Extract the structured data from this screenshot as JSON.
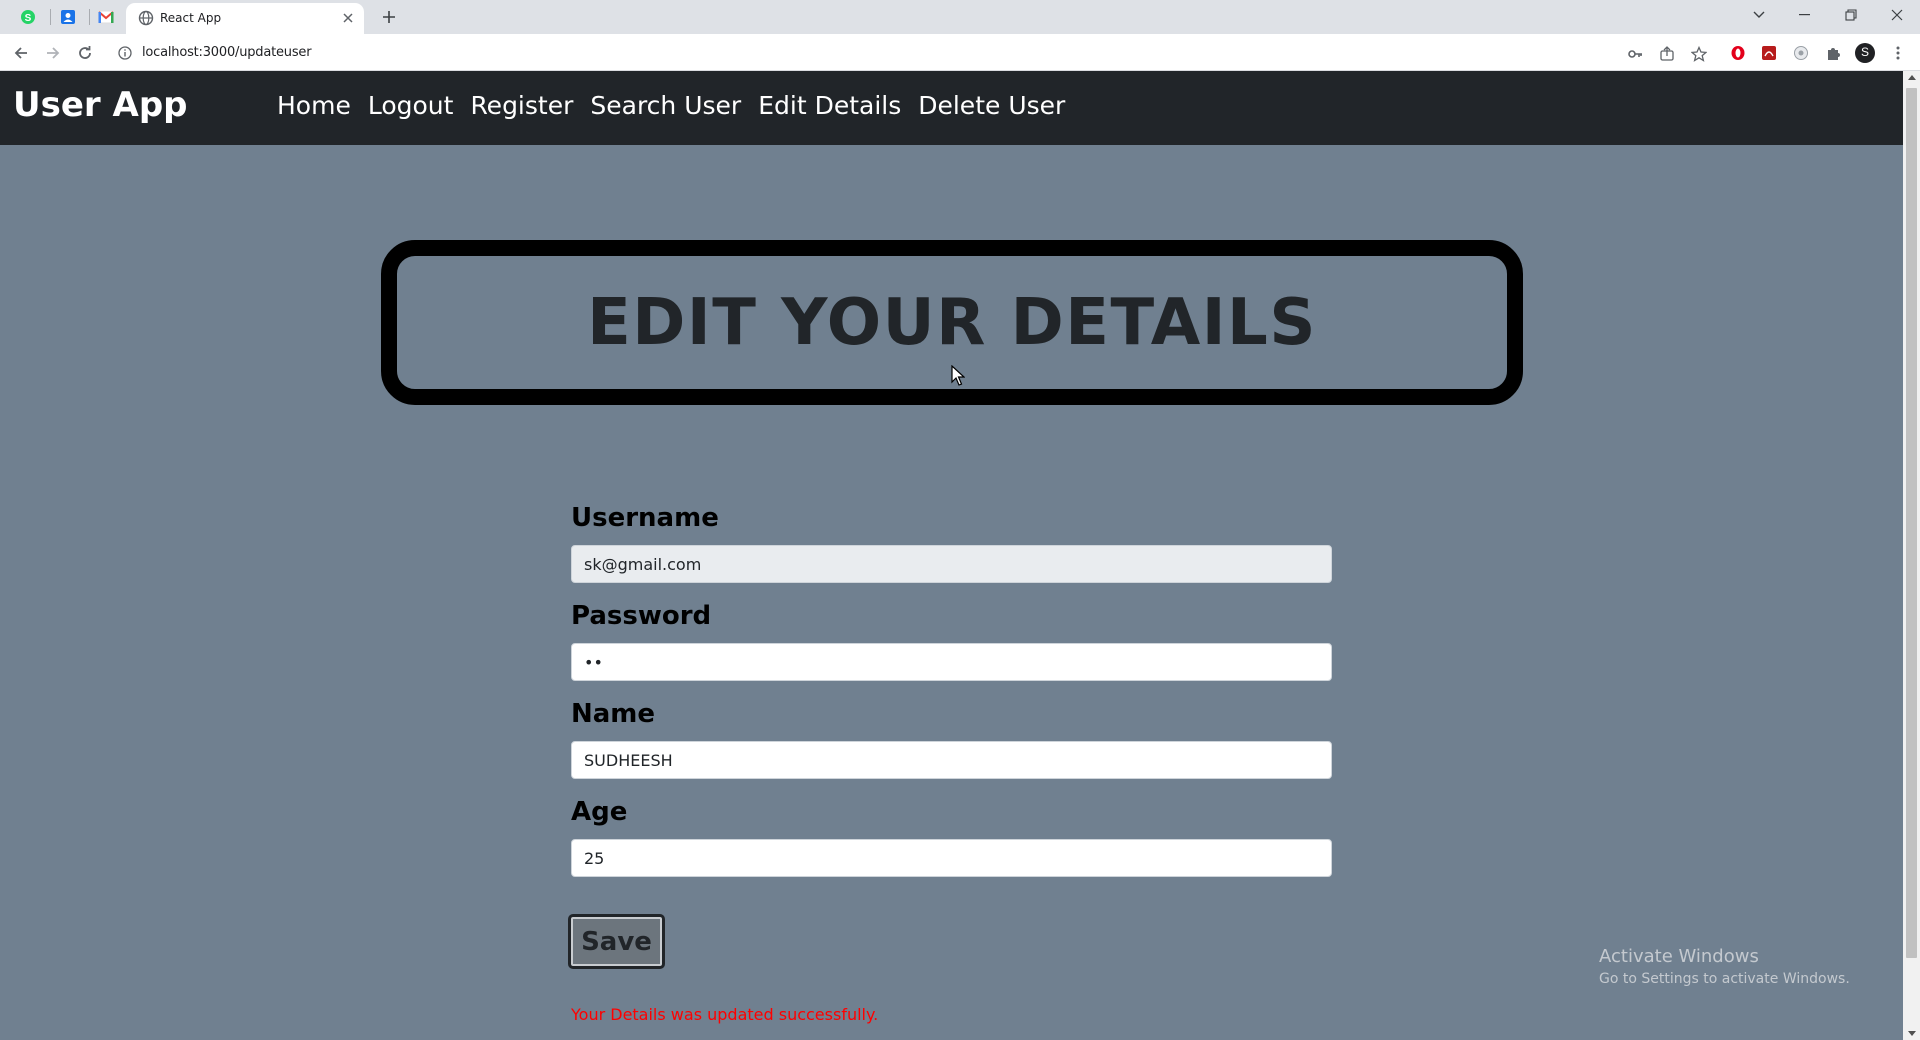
{
  "browser": {
    "tab_title": "React App",
    "url": "localhost:3000/updateuser",
    "profile_initial": "S",
    "pinned_tabs": [
      "whatsapp-icon",
      "contacts-icon",
      "gmail-icon"
    ]
  },
  "app": {
    "brand": "User App",
    "nav": {
      "home": "Home",
      "logout": "Logout",
      "register": "Register",
      "search_user": "Search User",
      "edit_details": "Edit Details",
      "delete_user": "Delete User"
    },
    "heading": "EDIT YOUR DETAILS",
    "form": {
      "username_label": "Username",
      "username_value": "sk@gmail.com",
      "password_label": "Password",
      "password_value": "••",
      "name_label": "Name",
      "name_value": "SUDHEESH",
      "age_label": "Age",
      "age_value": "25",
      "save_label": "Save"
    },
    "status_message": "Your Details was updated successfully."
  },
  "watermark": {
    "title": "Activate Windows",
    "subtitle": "Go to Settings to activate Windows."
  },
  "colors": {
    "navbar_bg": "#212529",
    "page_bg": "#708090",
    "status_text": "#ff0000"
  }
}
